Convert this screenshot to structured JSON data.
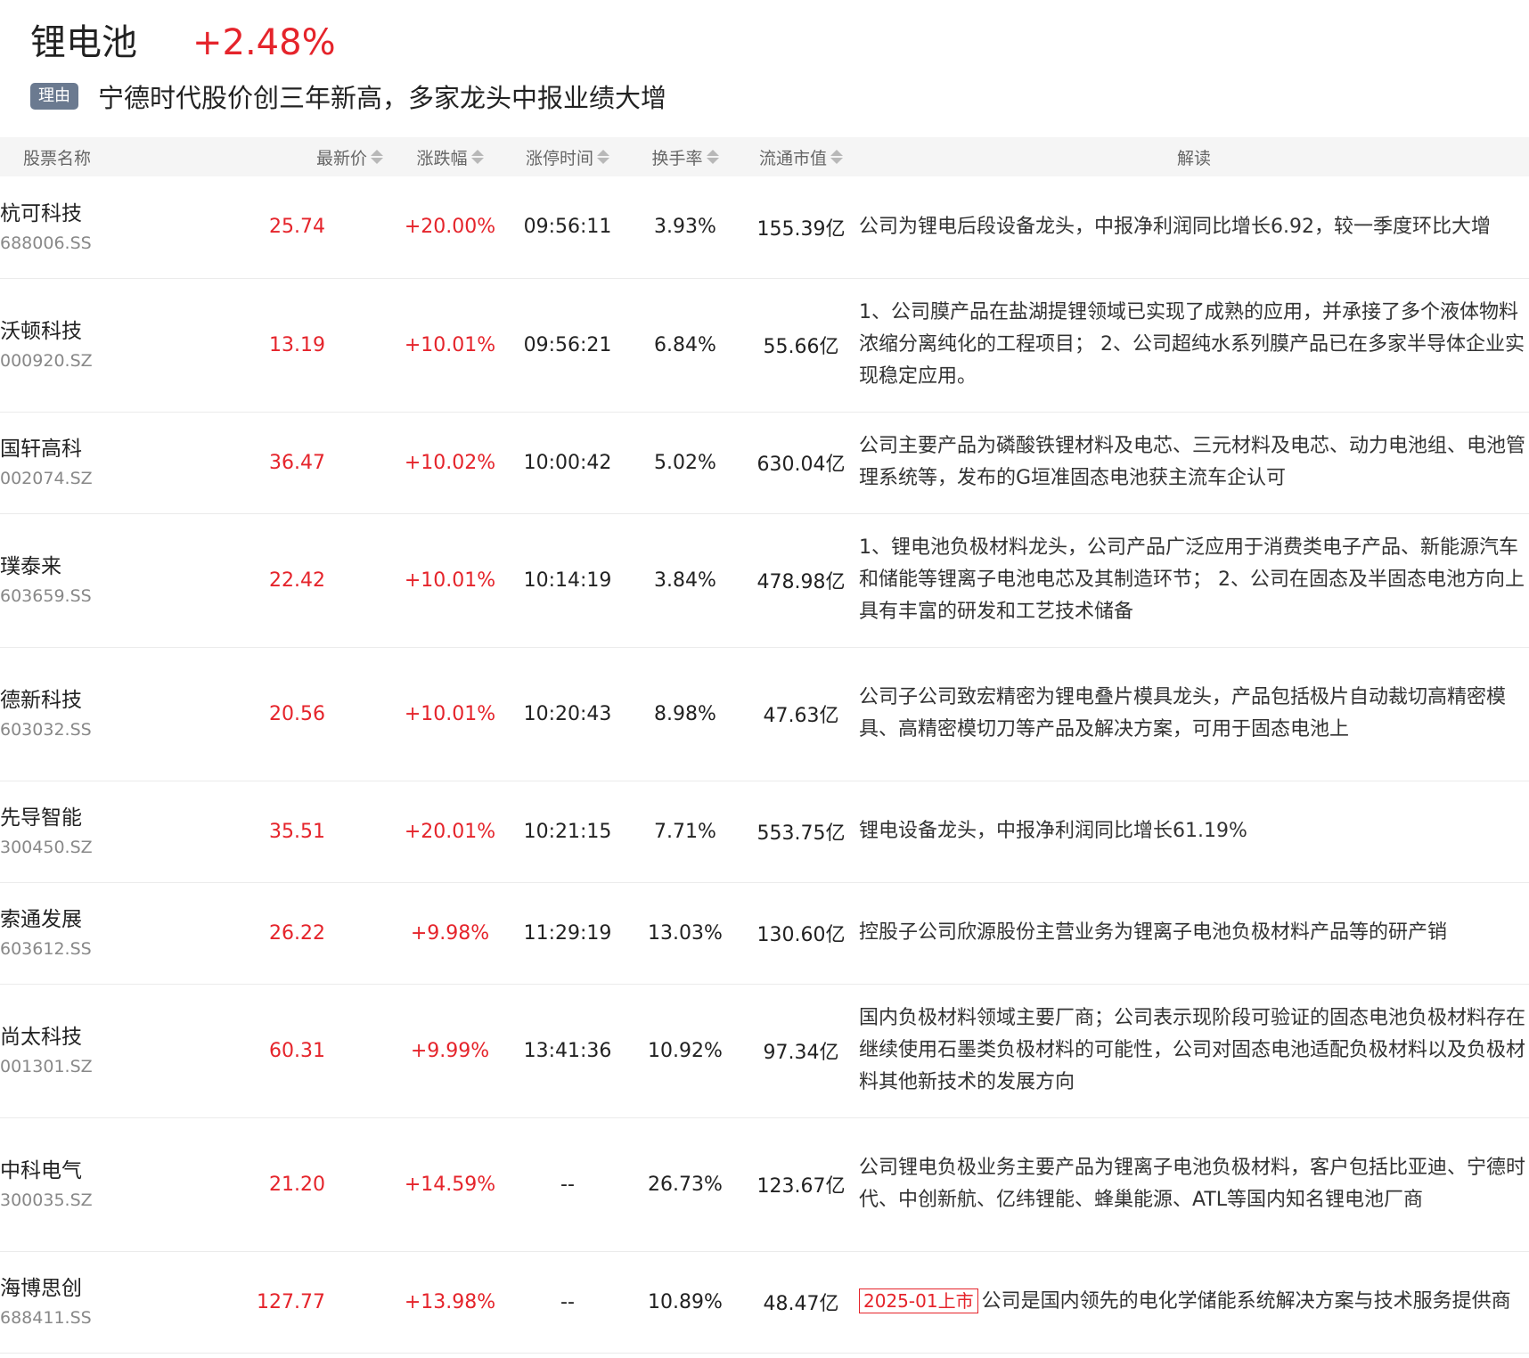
{
  "sector": {
    "name": "锂电池",
    "change": "+2.48%",
    "reason_tag": "理由",
    "reason": "宁德时代股价创三年新高，多家龙头中报业绩大增"
  },
  "table": {
    "columns": [
      "股票名称",
      "最新价",
      "涨跌幅",
      "涨停时间",
      "换手率",
      "流通市值",
      "解读"
    ],
    "rows": [
      {
        "name": "杭可科技",
        "code": "688006.SS",
        "price": "25.74",
        "change": "+20.00%",
        "limit_time": "09:56:11",
        "turnover": "3.93%",
        "market_cap": "155.39亿",
        "note": "公司为锂电后段设备龙头，中报净利润同比增长6.92，较一季度环比大增"
      },
      {
        "name": "沃顿科技",
        "code": "000920.SZ",
        "price": "13.19",
        "change": "+10.01%",
        "limit_time": "09:56:21",
        "turnover": "6.84%",
        "market_cap": "55.66亿",
        "note": "1、公司膜产品在盐湖提锂领域已实现了成熟的应用，并承接了多个液体物料浓缩分离纯化的工程项目； 2、公司超纯水系列膜产品已在多家半导体企业实现稳定应用。"
      },
      {
        "name": "国轩高科",
        "code": "002074.SZ",
        "price": "36.47",
        "change": "+10.02%",
        "limit_time": "10:00:42",
        "turnover": "5.02%",
        "market_cap": "630.04亿",
        "note": "公司主要产品为磷酸铁锂材料及电芯、三元材料及电芯、动力电池组、电池管理系统等，发布的G垣准固态电池获主流车企认可"
      },
      {
        "name": "璞泰来",
        "code": "603659.SS",
        "price": "22.42",
        "change": "+10.01%",
        "limit_time": "10:14:19",
        "turnover": "3.84%",
        "market_cap": "478.98亿",
        "note": "1、锂电池负极材料龙头，公司产品广泛应用于消费类电子产品、新能源汽车和储能等锂离子电池电芯及其制造环节； 2、公司在固态及半固态电池方向上具有丰富的研发和工艺技术储备"
      },
      {
        "name": "德新科技",
        "code": "603032.SS",
        "price": "20.56",
        "change": "+10.01%",
        "limit_time": "10:20:43",
        "turnover": "8.98%",
        "market_cap": "47.63亿",
        "note": "公司子公司致宏精密为锂电叠片模具龙头，产品包括极片自动裁切高精密模具、高精密模切刀等产品及解决方案，可用于固态电池上"
      },
      {
        "name": "先导智能",
        "code": "300450.SZ",
        "price": "35.51",
        "change": "+20.01%",
        "limit_time": "10:21:15",
        "turnover": "7.71%",
        "market_cap": "553.75亿",
        "note": "锂电设备龙头，中报净利润同比增长61.19%"
      },
      {
        "name": "索通发展",
        "code": "603612.SS",
        "price": "26.22",
        "change": "+9.98%",
        "limit_time": "11:29:19",
        "turnover": "13.03%",
        "market_cap": "130.60亿",
        "note": "控股子公司欣源股份主营业务为锂离子电池负极材料产品等的研产销"
      },
      {
        "name": "尚太科技",
        "code": "001301.SZ",
        "price": "60.31",
        "change": "+9.99%",
        "limit_time": "13:41:36",
        "turnover": "10.92%",
        "market_cap": "97.34亿",
        "note": "国内负极材料领域主要厂商；公司表示现阶段可验证的固态电池负极材料存在继续使用石墨类负极材料的可能性，公司对固态电池适配负极材料以及负极材料其他新技术的发展方向"
      },
      {
        "name": "中科电气",
        "code": "300035.SZ",
        "price": "21.20",
        "change": "+14.59%",
        "limit_time": "--",
        "turnover": "26.73%",
        "market_cap": "123.67亿",
        "note": "公司锂电负极业务主要产品为锂离子电池负极材料，客户包括比亚迪、宁德时代、中创新航、亿纬锂能、蜂巢能源、ATL等国内知名锂电池厂商"
      },
      {
        "name": "海博思创",
        "code": "688411.SS",
        "price": "127.77",
        "change": "+13.98%",
        "limit_time": "--",
        "turnover": "10.89%",
        "market_cap": "48.47亿",
        "badge": "2025-01上市",
        "note": "公司是国内领先的电化学储能系统解决方案与技术服务提供商"
      }
    ]
  }
}
